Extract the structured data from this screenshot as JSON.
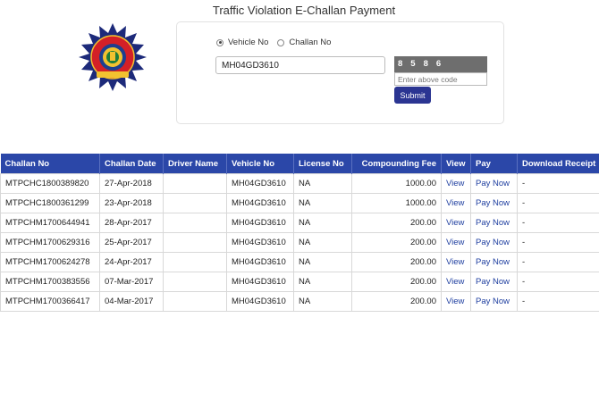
{
  "header": {
    "title": "Traffic Violation E-Challan Payment"
  },
  "form": {
    "radio_vehicle": "Vehicle No",
    "radio_challan": "Challan No",
    "vehicle_value": "MH04GD3610",
    "captcha_code": "8586",
    "captcha_placeholder": "Enter above code",
    "submit_label": "Submit"
  },
  "table": {
    "headers": [
      "Challan No",
      "Challan Date",
      "Driver Name",
      "Vehicle No",
      "License No",
      "Compounding Fee",
      "View",
      "Pay",
      "Download Receipt"
    ],
    "rows": [
      {
        "challan_no": "MTPCHC1800389820",
        "date": "27-Apr-2018",
        "driver": "",
        "vehicle": "MH04GD3610",
        "license": "NA",
        "fee": "1000.00",
        "view": "View",
        "pay": "Pay Now",
        "receipt": "-"
      },
      {
        "challan_no": "MTPCHC1800361299",
        "date": "23-Apr-2018",
        "driver": "",
        "vehicle": "MH04GD3610",
        "license": "NA",
        "fee": "1000.00",
        "view": "View",
        "pay": "Pay Now",
        "receipt": "-"
      },
      {
        "challan_no": "MTPCHM1700644941",
        "date": "28-Apr-2017",
        "driver": "",
        "vehicle": "MH04GD3610",
        "license": "NA",
        "fee": "200.00",
        "view": "View",
        "pay": "Pay Now",
        "receipt": "-"
      },
      {
        "challan_no": "MTPCHM1700629316",
        "date": "25-Apr-2017",
        "driver": "",
        "vehicle": "MH04GD3610",
        "license": "NA",
        "fee": "200.00",
        "view": "View",
        "pay": "Pay Now",
        "receipt": "-"
      },
      {
        "challan_no": "MTPCHM1700624278",
        "date": "24-Apr-2017",
        "driver": "",
        "vehicle": "MH04GD3610",
        "license": "NA",
        "fee": "200.00",
        "view": "View",
        "pay": "Pay Now",
        "receipt": "-"
      },
      {
        "challan_no": "MTPCHM1700383556",
        "date": "07-Mar-2017",
        "driver": "",
        "vehicle": "MH04GD3610",
        "license": "NA",
        "fee": "200.00",
        "view": "View",
        "pay": "Pay Now",
        "receipt": "-"
      },
      {
        "challan_no": "MTPCHM1700366417",
        "date": "04-Mar-2017",
        "driver": "",
        "vehicle": "MH04GD3610",
        "license": "NA",
        "fee": "200.00",
        "view": "View",
        "pay": "Pay Now",
        "receipt": "-"
      }
    ]
  },
  "colors": {
    "header_bg": "#2b47a8",
    "button_bg": "#2b3592",
    "link": "#1f3fa0",
    "captcha_bg": "#6e6e6e"
  },
  "icons": {
    "logo": "police-emblem-icon"
  }
}
